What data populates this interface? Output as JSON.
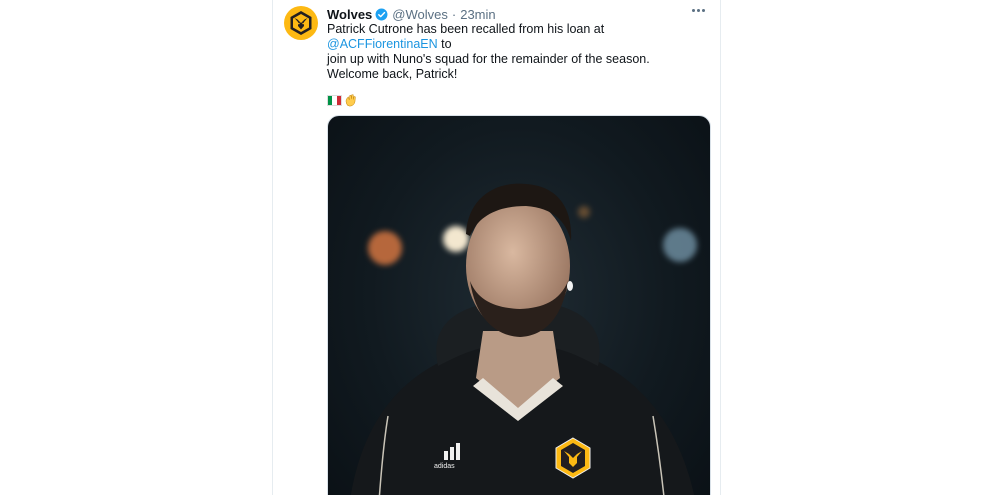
{
  "tweet": {
    "author": {
      "display_name": "Wolves",
      "handle": "@Wolves",
      "verified": true,
      "avatar_icon": "wolves-crest-icon"
    },
    "separator": "·",
    "time": "23min",
    "text": {
      "part1": "Patrick Cutrone has been recalled from his loan at ",
      "mention": "@ACFFiorentinaEN",
      "part2": " to",
      "line2": "join up with Nuno's squad for the remainder of the season."
    },
    "welcome": "Welcome back, Patrick!",
    "emoji_icons": [
      "italy-flag-icon",
      "waving-hand-icon"
    ],
    "media": {
      "description_icon": "player-photo",
      "kit_brand": "adidas"
    }
  },
  "colors": {
    "link": "#1b95e0",
    "secondary": "#5b7083",
    "brand_gold": "#fdb913",
    "verified": "#1da1f2"
  }
}
